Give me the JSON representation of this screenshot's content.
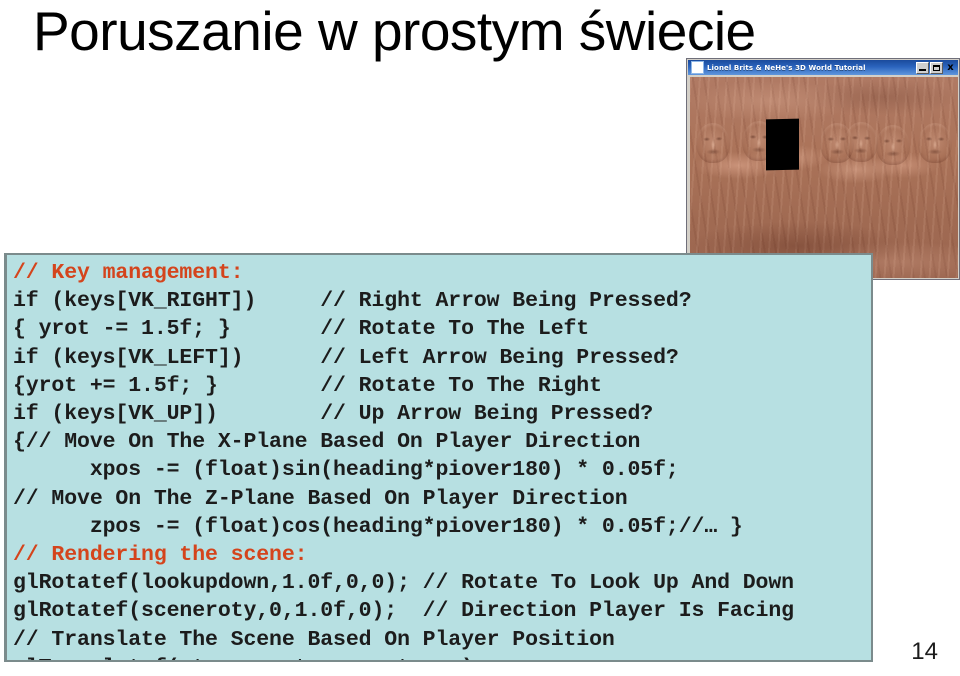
{
  "slide": {
    "title": "Poruszanie w prostym świecie",
    "page_number": "14"
  },
  "app_window": {
    "title": "Lionel Brits & NeHe's 3D World Tutorial",
    "icon": "app-window-icon",
    "minimize_label": "",
    "maximize_label": "",
    "close_label": "x",
    "viewport": {
      "description": "textured red-brown stone wall with carved faces and black doorway",
      "wall_color": "#a9705c",
      "doorway_color": "#000000"
    }
  },
  "code": {
    "background_color": "#b7e0e2",
    "comment_color": "#d4441c",
    "lines": [
      {
        "text": "// Key management:",
        "style": "comment-red"
      },
      {
        "text": "if (keys[VK_RIGHT])     // Right Arrow Being Pressed?",
        "style": "normal"
      },
      {
        "text": "{ yrot -= 1.5f; }       // Rotate To The Left",
        "style": "normal"
      },
      {
        "text": "if (keys[VK_LEFT])      // Left Arrow Being Pressed?",
        "style": "normal"
      },
      {
        "text": "{yrot += 1.5f; }        // Rotate To The Right",
        "style": "normal"
      },
      {
        "text": "if (keys[VK_UP])        // Up Arrow Being Pressed?",
        "style": "normal"
      },
      {
        "text": "{// Move On The X-Plane Based On Player Direction",
        "style": "normal"
      },
      {
        "text": "      xpos -= (float)sin(heading*piover180) * 0.05f;",
        "style": "normal"
      },
      {
        "text": "// Move On The Z-Plane Based On Player Direction",
        "style": "normal"
      },
      {
        "text": "      zpos -= (float)cos(heading*piover180) * 0.05f;//… }",
        "style": "normal"
      },
      {
        "text": "// Rendering the scene:",
        "style": "comment-red"
      },
      {
        "text": "glRotatef(lookupdown,1.0f,0,0); // Rotate To Look Up And Down",
        "style": "normal"
      },
      {
        "text": "glRotatef(sceneroty,0,1.0f,0);  // Direction Player Is Facing",
        "style": "normal"
      },
      {
        "text": "// Translate The Scene Based On Player Position",
        "style": "normal"
      },
      {
        "text": "glTranslatef(xtrans, ytrans, ztrans);",
        "style": "normal"
      }
    ]
  }
}
